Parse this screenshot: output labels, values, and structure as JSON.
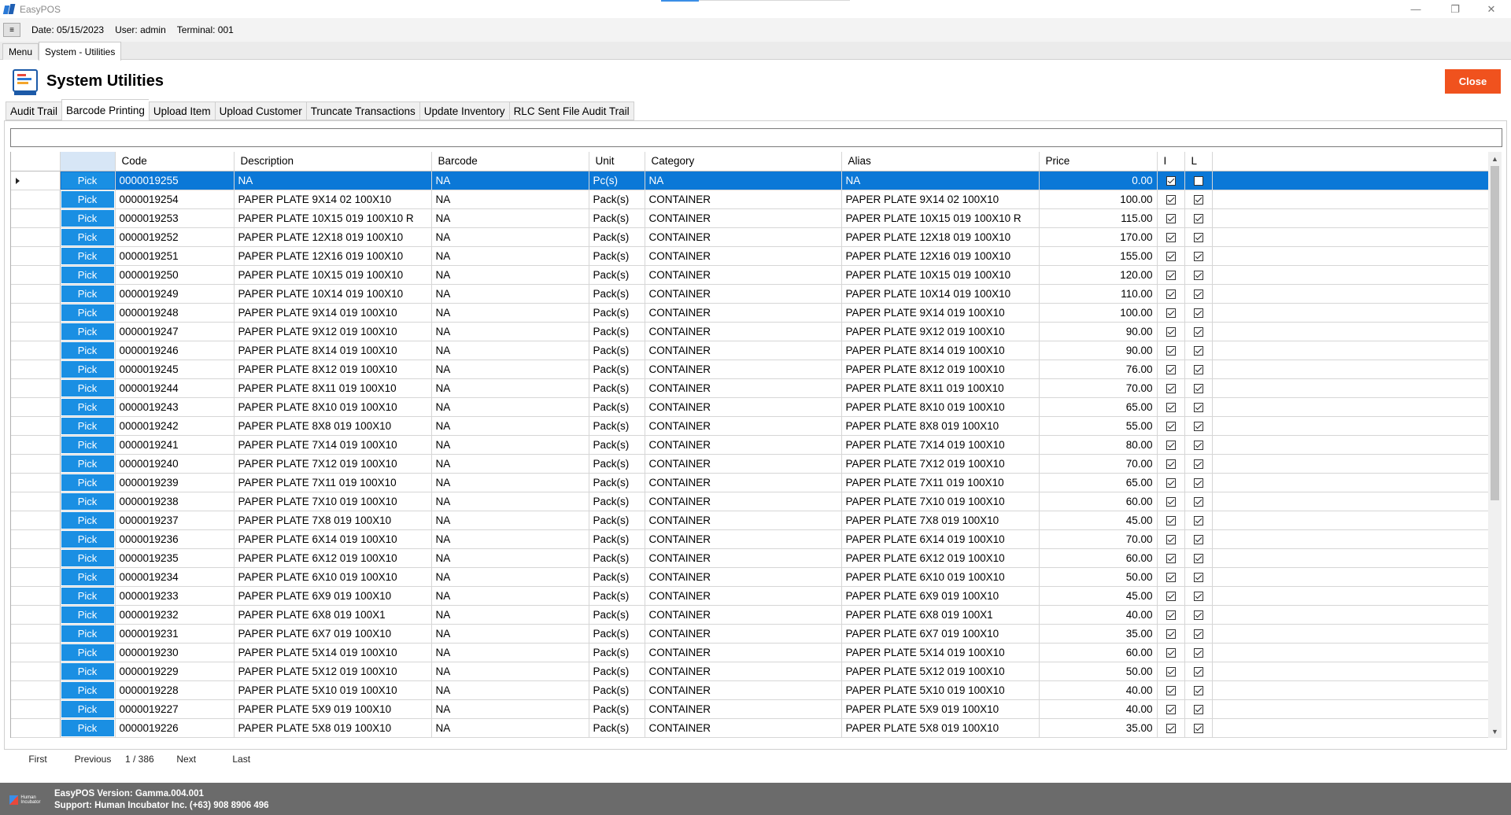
{
  "window": {
    "title": "EasyPOS",
    "minimize_icon": "minimize-icon",
    "restore_icon": "restore-icon",
    "close_icon": "close-icon"
  },
  "infobar": {
    "menu_icon": "hamburger-icon",
    "date": "Date: 05/15/2023",
    "user": "User: admin",
    "terminal": "Terminal: 001"
  },
  "top_tabs": [
    {
      "label": "Menu"
    },
    {
      "label": "System - Utilities"
    }
  ],
  "header": {
    "title": "System Utilities",
    "close_label": "Close"
  },
  "utility_tabs": [
    {
      "label": "Audit Trail"
    },
    {
      "label": "Barcode Printing"
    },
    {
      "label": "Upload Item"
    },
    {
      "label": "Upload Customer"
    },
    {
      "label": "Truncate Transactions"
    },
    {
      "label": "Update Inventory"
    },
    {
      "label": "RLC Sent File Audit Trail"
    }
  ],
  "active_utility_tab": "Barcode Printing",
  "search": {
    "value": "",
    "placeholder": ""
  },
  "grid": {
    "pick_label": "Pick",
    "columns": [
      "",
      "",
      "Code",
      "Description",
      "Barcode",
      "Unit",
      "Category",
      "Alias",
      "Price",
      "I",
      "L"
    ],
    "rows": [
      {
        "code": "0000019255",
        "description": "NA",
        "barcode": "NA",
        "unit": "Pc(s)",
        "category": "NA",
        "alias": "NA",
        "price": "0.00",
        "i": true,
        "l": false,
        "selected": true
      },
      {
        "code": "0000019254",
        "description": "PAPER PLATE  9X14 02 100X10",
        "barcode": "NA",
        "unit": "Pack(s)",
        "category": "CONTAINER",
        "alias": "PAPER PLATE  9X14 02 100X10",
        "price": "100.00",
        "i": true,
        "l": true
      },
      {
        "code": "0000019253",
        "description": "PAPER PLATE  10X15 019 100X10 R",
        "barcode": "NA",
        "unit": "Pack(s)",
        "category": "CONTAINER",
        "alias": "PAPER PLATE  10X15 019 100X10 R",
        "price": "115.00",
        "i": true,
        "l": true
      },
      {
        "code": "0000019252",
        "description": "PAPER PLATE  12X18 019 100X10",
        "barcode": "NA",
        "unit": "Pack(s)",
        "category": "CONTAINER",
        "alias": "PAPER PLATE  12X18 019 100X10",
        "price": "170.00",
        "i": true,
        "l": true
      },
      {
        "code": "0000019251",
        "description": "PAPER PLATE  12X16 019 100X10",
        "barcode": "NA",
        "unit": "Pack(s)",
        "category": "CONTAINER",
        "alias": "PAPER PLATE  12X16 019 100X10",
        "price": "155.00",
        "i": true,
        "l": true
      },
      {
        "code": "0000019250",
        "description": "PAPER PLATE  10X15 019 100X10",
        "barcode": "NA",
        "unit": "Pack(s)",
        "category": "CONTAINER",
        "alias": "PAPER PLATE  10X15 019 100X10",
        "price": "120.00",
        "i": true,
        "l": true
      },
      {
        "code": "0000019249",
        "description": "PAPER PLATE  10X14 019 100X10",
        "barcode": "NA",
        "unit": "Pack(s)",
        "category": "CONTAINER",
        "alias": "PAPER PLATE  10X14 019 100X10",
        "price": "110.00",
        "i": true,
        "l": true
      },
      {
        "code": "0000019248",
        "description": "PAPER PLATE  9X14 019 100X10",
        "barcode": "NA",
        "unit": "Pack(s)",
        "category": "CONTAINER",
        "alias": "PAPER PLATE  9X14 019 100X10",
        "price": "100.00",
        "i": true,
        "l": true
      },
      {
        "code": "0000019247",
        "description": "PAPER PLATE  9X12 019 100X10",
        "barcode": "NA",
        "unit": "Pack(s)",
        "category": "CONTAINER",
        "alias": "PAPER PLATE  9X12 019 100X10",
        "price": "90.00",
        "i": true,
        "l": true
      },
      {
        "code": "0000019246",
        "description": "PAPER PLATE  8X14 019 100X10",
        "barcode": "NA",
        "unit": "Pack(s)",
        "category": "CONTAINER",
        "alias": "PAPER PLATE  8X14 019 100X10",
        "price": "90.00",
        "i": true,
        "l": true
      },
      {
        "code": "0000019245",
        "description": "PAPER PLATE  8X12 019 100X10",
        "barcode": "NA",
        "unit": "Pack(s)",
        "category": "CONTAINER",
        "alias": "PAPER PLATE  8X12 019 100X10",
        "price": "76.00",
        "i": true,
        "l": true
      },
      {
        "code": "0000019244",
        "description": "PAPER PLATE  8X11 019 100X10",
        "barcode": "NA",
        "unit": "Pack(s)",
        "category": "CONTAINER",
        "alias": "PAPER PLATE  8X11 019 100X10",
        "price": "70.00",
        "i": true,
        "l": true
      },
      {
        "code": "0000019243",
        "description": "PAPER PLATE  8X10 019 100X10",
        "barcode": "NA",
        "unit": "Pack(s)",
        "category": "CONTAINER",
        "alias": "PAPER PLATE  8X10 019 100X10",
        "price": "65.00",
        "i": true,
        "l": true
      },
      {
        "code": "0000019242",
        "description": "PAPER PLATE 8X8 019 100X10",
        "barcode": "NA",
        "unit": "Pack(s)",
        "category": "CONTAINER",
        "alias": "PAPER PLATE 8X8 019 100X10",
        "price": "55.00",
        "i": true,
        "l": true
      },
      {
        "code": "0000019241",
        "description": "PAPER PLATE  7X14 019 100X10",
        "barcode": "NA",
        "unit": "Pack(s)",
        "category": "CONTAINER",
        "alias": "PAPER PLATE  7X14 019 100X10",
        "price": "80.00",
        "i": true,
        "l": true
      },
      {
        "code": "0000019240",
        "description": "PAPER PLATE  7X12 019 100X10",
        "barcode": "NA",
        "unit": "Pack(s)",
        "category": "CONTAINER",
        "alias": "PAPER PLATE  7X12 019 100X10",
        "price": "70.00",
        "i": true,
        "l": true
      },
      {
        "code": "0000019239",
        "description": "PAPER PLATE 7X11 019 100X10",
        "barcode": "NA",
        "unit": "Pack(s)",
        "category": "CONTAINER",
        "alias": "PAPER PLATE 7X11 019 100X10",
        "price": "65.00",
        "i": true,
        "l": true
      },
      {
        "code": "0000019238",
        "description": "PAPER PLATE 7X10 019 100X10",
        "barcode": "NA",
        "unit": "Pack(s)",
        "category": "CONTAINER",
        "alias": "PAPER PLATE 7X10 019 100X10",
        "price": "60.00",
        "i": true,
        "l": true
      },
      {
        "code": "0000019237",
        "description": "PAPER PLATE 7X8 019 100X10",
        "barcode": "NA",
        "unit": "Pack(s)",
        "category": "CONTAINER",
        "alias": "PAPER PLATE 7X8 019 100X10",
        "price": "45.00",
        "i": true,
        "l": true
      },
      {
        "code": "0000019236",
        "description": "PAPER PLATE 6X14 019 100X10",
        "barcode": "NA",
        "unit": "Pack(s)",
        "category": "CONTAINER",
        "alias": "PAPER PLATE 6X14 019 100X10",
        "price": "70.00",
        "i": true,
        "l": true
      },
      {
        "code": "0000019235",
        "description": "PAPER PLATE  6X12 019 100X10",
        "barcode": "NA",
        "unit": "Pack(s)",
        "category": "CONTAINER",
        "alias": "PAPER PLATE  6X12 019 100X10",
        "price": "60.00",
        "i": true,
        "l": true
      },
      {
        "code": "0000019234",
        "description": "PAPER PLATE  6X10 019 100X10",
        "barcode": "NA",
        "unit": "Pack(s)",
        "category": "CONTAINER",
        "alias": "PAPER PLATE  6X10 019 100X10",
        "price": "50.00",
        "i": true,
        "l": true
      },
      {
        "code": "0000019233",
        "description": "PAPER PLATE  6X9 019 100X10",
        "barcode": "NA",
        "unit": "Pack(s)",
        "category": "CONTAINER",
        "alias": "PAPER PLATE  6X9 019 100X10",
        "price": "45.00",
        "i": true,
        "l": true
      },
      {
        "code": "0000019232",
        "description": "PAPER PLATE  6X8 019 100X1",
        "barcode": "NA",
        "unit": "Pack(s)",
        "category": "CONTAINER",
        "alias": "PAPER PLATE  6X8 019 100X1",
        "price": "40.00",
        "i": true,
        "l": true
      },
      {
        "code": "0000019231",
        "description": "PAPER PLATE  6X7 019 100X10",
        "barcode": "NA",
        "unit": "Pack(s)",
        "category": "CONTAINER",
        "alias": "PAPER PLATE  6X7 019 100X10",
        "price": "35.00",
        "i": true,
        "l": true
      },
      {
        "code": "0000019230",
        "description": "PAPER PLATE  5X14 019 100X10",
        "barcode": "NA",
        "unit": "Pack(s)",
        "category": "CONTAINER",
        "alias": "PAPER PLATE  5X14 019 100X10",
        "price": "60.00",
        "i": true,
        "l": true
      },
      {
        "code": "0000019229",
        "description": "PAPER PLATE  5X12 019 100X10",
        "barcode": "NA",
        "unit": "Pack(s)",
        "category": "CONTAINER",
        "alias": "PAPER PLATE  5X12 019 100X10",
        "price": "50.00",
        "i": true,
        "l": true
      },
      {
        "code": "0000019228",
        "description": "PAPER PLATE 5X10 019 100X10",
        "barcode": "NA",
        "unit": "Pack(s)",
        "category": "CONTAINER",
        "alias": "PAPER PLATE 5X10 019 100X10",
        "price": "40.00",
        "i": true,
        "l": true
      },
      {
        "code": "0000019227",
        "description": "PAPER PLATE  5X9 019 100X10",
        "barcode": "NA",
        "unit": "Pack(s)",
        "category": "CONTAINER",
        "alias": "PAPER PLATE 5X9 019 100X10",
        "price": "40.00",
        "i": true,
        "l": true
      },
      {
        "code": "0000019226",
        "description": "PAPER PLATE  5X8 019 100X10",
        "barcode": "NA",
        "unit": "Pack(s)",
        "category": "CONTAINER",
        "alias": "PAPER PLATE  5X8 019 100X10",
        "price": "35.00",
        "i": true,
        "l": true
      }
    ]
  },
  "pager": {
    "first": "First",
    "previous": "Previous",
    "info": "1 / 386",
    "next": "Next",
    "last": "Last"
  },
  "footer": {
    "logo_text": "Human Incubator",
    "version": "EasyPOS Version: Gamma.004.001",
    "support": "Support: Human Incubator Inc. (+63) 908 8906 496"
  },
  "colors": {
    "accent": "#0b78d7",
    "pick_button": "#1a8fe3",
    "close_button": "#f0521e",
    "footer": "#6b6b6b"
  }
}
